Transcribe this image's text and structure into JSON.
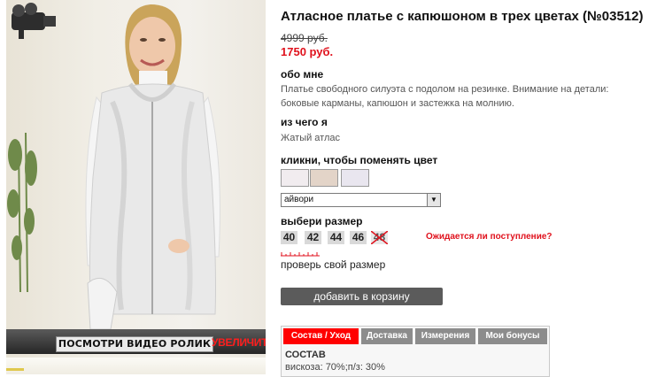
{
  "product": {
    "title": "Атласное платье с капюшоном в трех цветах (№03512)",
    "old_price": "4999 руб.",
    "new_price": "1750 руб."
  },
  "about": {
    "heading": "обо мне",
    "text": "Платье свободного силуэта с подолом на резинке. Внимание на детали: боковые карманы, капюшон и застежка на молнию."
  },
  "material": {
    "heading": "из чего я",
    "text": "Жатый атлас"
  },
  "colors": {
    "heading": "кликни, чтобы поменять цвет",
    "swatches": [
      "#f1ecef",
      "#e3d4c8",
      "#e9e6ef"
    ],
    "selected": "айвори"
  },
  "sizes": {
    "heading": "выбери размер",
    "items": [
      "40",
      "42",
      "44",
      "46",
      "48"
    ],
    "sold_out": "48",
    "wait_link": "Ожидается ли поступление?",
    "check_link": "проверь свой размер"
  },
  "cart_button": "добавить в корзину",
  "photo": {
    "video_label": "ПОСМОТРИ ВИДЕО РОЛИК",
    "zoom_label": "УВЕЛИЧИТЬ"
  },
  "tabs": {
    "items": [
      "Состав / Уход",
      "Доставка",
      "Измерения",
      "Мои бонусы"
    ],
    "active": "Состав / Уход",
    "section_title": "СОСТАВ",
    "section_text": "вискоза: 70%;п/з: 30%"
  },
  "colors_ui": {
    "price_red": "#e0121d",
    "active_tab": "#ff0000",
    "button_gray": "#5b5b5b"
  }
}
